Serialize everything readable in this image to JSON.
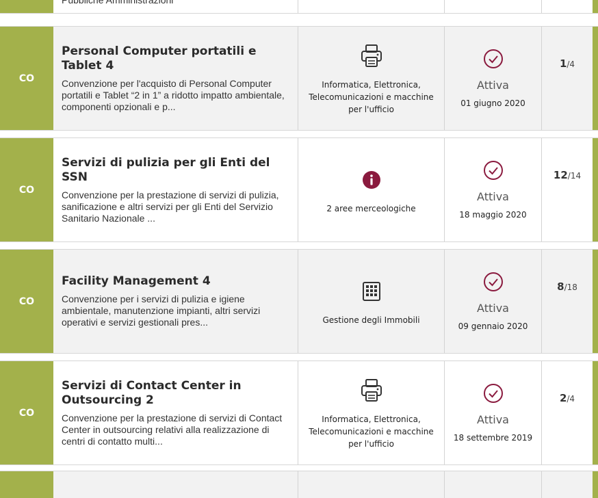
{
  "top_partial": {
    "desc_fragment": "Pubbliche Amministrazioni"
  },
  "rows": [
    {
      "code": "CO",
      "title": "Personal Computer portatili e Tablet 4",
      "description": "Convenzione per l'acquisto di Personal Computer portatili e Tablet “2 in 1” a ridotto impatto ambientale, componenti opzionali e p...",
      "category_icon": "printer-icon",
      "category": "Informatica, Elettronica, Telecomunicazioni e macchine per l'ufficio",
      "status": "Attiva",
      "date": "01 giugno 2020",
      "lot_current": "1",
      "lot_total": "/4"
    },
    {
      "code": "CO",
      "title": "Servizi di pulizia per gli Enti del SSN",
      "description": "Convenzione per la prestazione di servizi di pulizia, sanificazione e altri servizi per gli Enti del Servizio Sanitario Nazionale ...",
      "category_icon": "info-icon",
      "category": "2 aree merceologiche",
      "status": "Attiva",
      "date": "18 maggio 2020",
      "lot_current": "12",
      "lot_total": "/14"
    },
    {
      "code": "CO",
      "title": "Facility Management 4",
      "description": "Convenzione per i servizi di pulizia e igiene ambientale, manutenzione impianti, altri servizi operativi e servizi gestionali pres...",
      "category_icon": "building-icon",
      "category": "Gestione degli Immobili",
      "status": "Attiva",
      "date": "09 gennaio 2020",
      "lot_current": "8",
      "lot_total": "/18"
    },
    {
      "code": "CO",
      "title": "Servizi di Contact Center in Outsourcing 2",
      "description": "Convenzione per la prestazione di servizi di Contact Center in outsourcing relativi alla realizzazione di centri di contatto multi...",
      "category_icon": "printer-icon",
      "category": "Informatica, Elettronica, Telecomunicazioni e macchine per l'ufficio",
      "status": "Attiva",
      "date": "18 settembre 2019",
      "lot_current": "2",
      "lot_total": "/4"
    }
  ],
  "colors": {
    "accent": "#a3b14b",
    "status_icon": "#8a1a3e",
    "info_icon": "#8a1a3e"
  }
}
